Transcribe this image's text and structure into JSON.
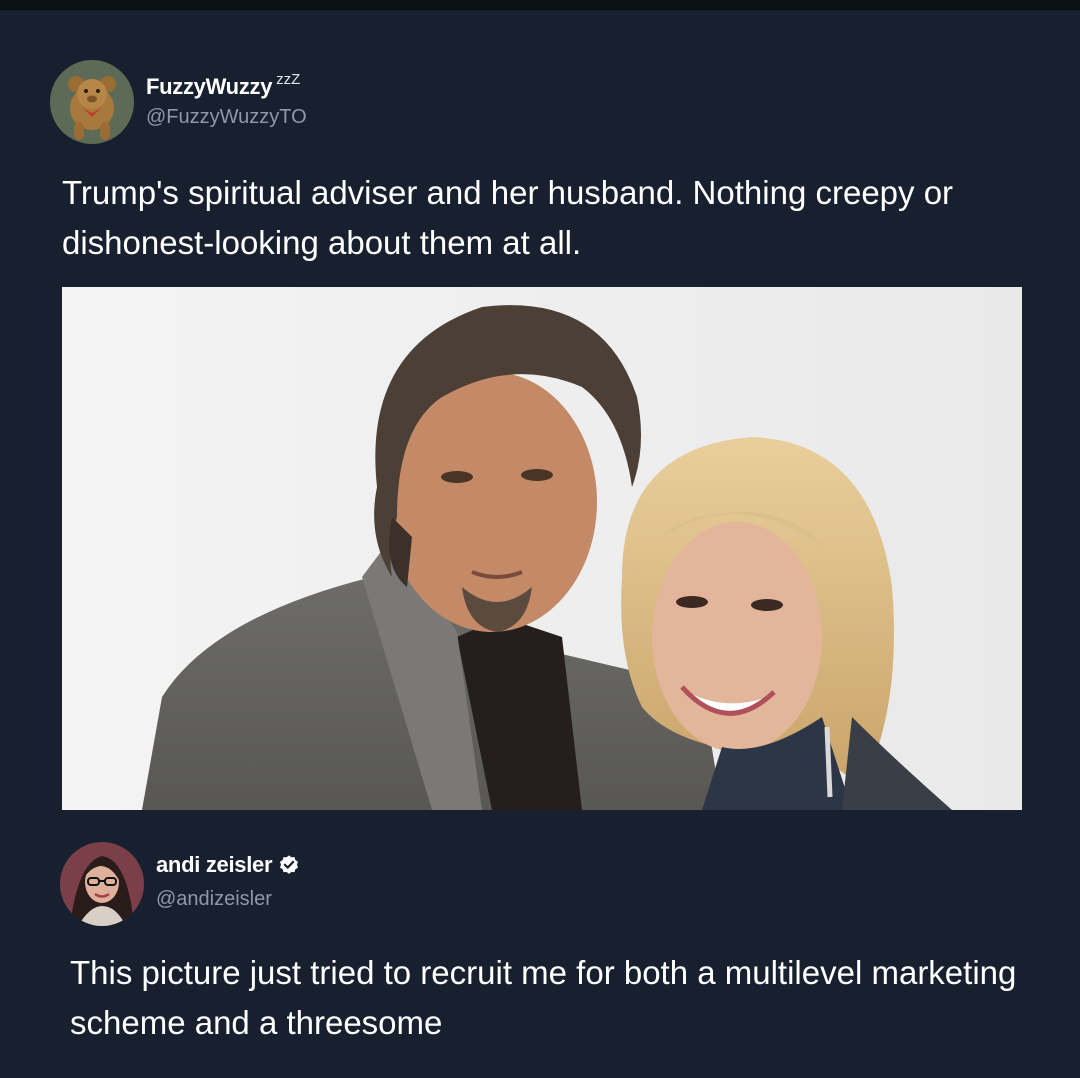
{
  "tweets": [
    {
      "display_name": "FuzzyWuzzy",
      "name_suffix": "zᴢZ",
      "handle": "@FuzzyWuzzyTO",
      "avatar_icon": "teddy-bear-avatar",
      "text": "Trump's spiritual adviser and her husband. Nothing creepy or dishonest-looking about them at all.",
      "image_icon": "couple-portrait-photo"
    },
    {
      "display_name": "andi zeisler",
      "verified": true,
      "handle": "@andizeisler",
      "avatar_icon": "woman-portrait-avatar",
      "text": "This picture just tried to recruit me for both a multilevel marketing scheme and a threesome"
    }
  ],
  "colors": {
    "background": "#18202f",
    "text_primary": "#ffffff",
    "text_secondary": "#8d98a8"
  }
}
